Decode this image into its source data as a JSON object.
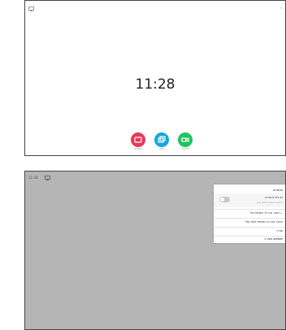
{
  "screen1": {
    "clock": "11:28",
    "buttons": [
      {
        "name": "call",
        "label": "התקשר",
        "color": "#e8385a"
      },
      {
        "name": "share",
        "label": "שתף",
        "color": "#14a6d8"
      },
      {
        "name": "copy",
        "label": "שכפול",
        "color": "#22c25e"
      }
    ]
  },
  "screen2": {
    "status_time": "11:28",
    "menu": {
      "header": "מסמכים",
      "dnd_title": "נא לא להפריע",
      "dnd_subtitle": "הודעות הושבתו לזמן ידוע",
      "items": [
        "העבר את כל השיחות אל...",
        "העבר את כל השיחות לתא קולי",
        "עזרה",
        "פתח ב-webex"
      ]
    }
  },
  "colors": {
    "overlay": "#b5b5b5",
    "menu_bg": "#ffffff",
    "toggle": "#c9c9c9"
  }
}
